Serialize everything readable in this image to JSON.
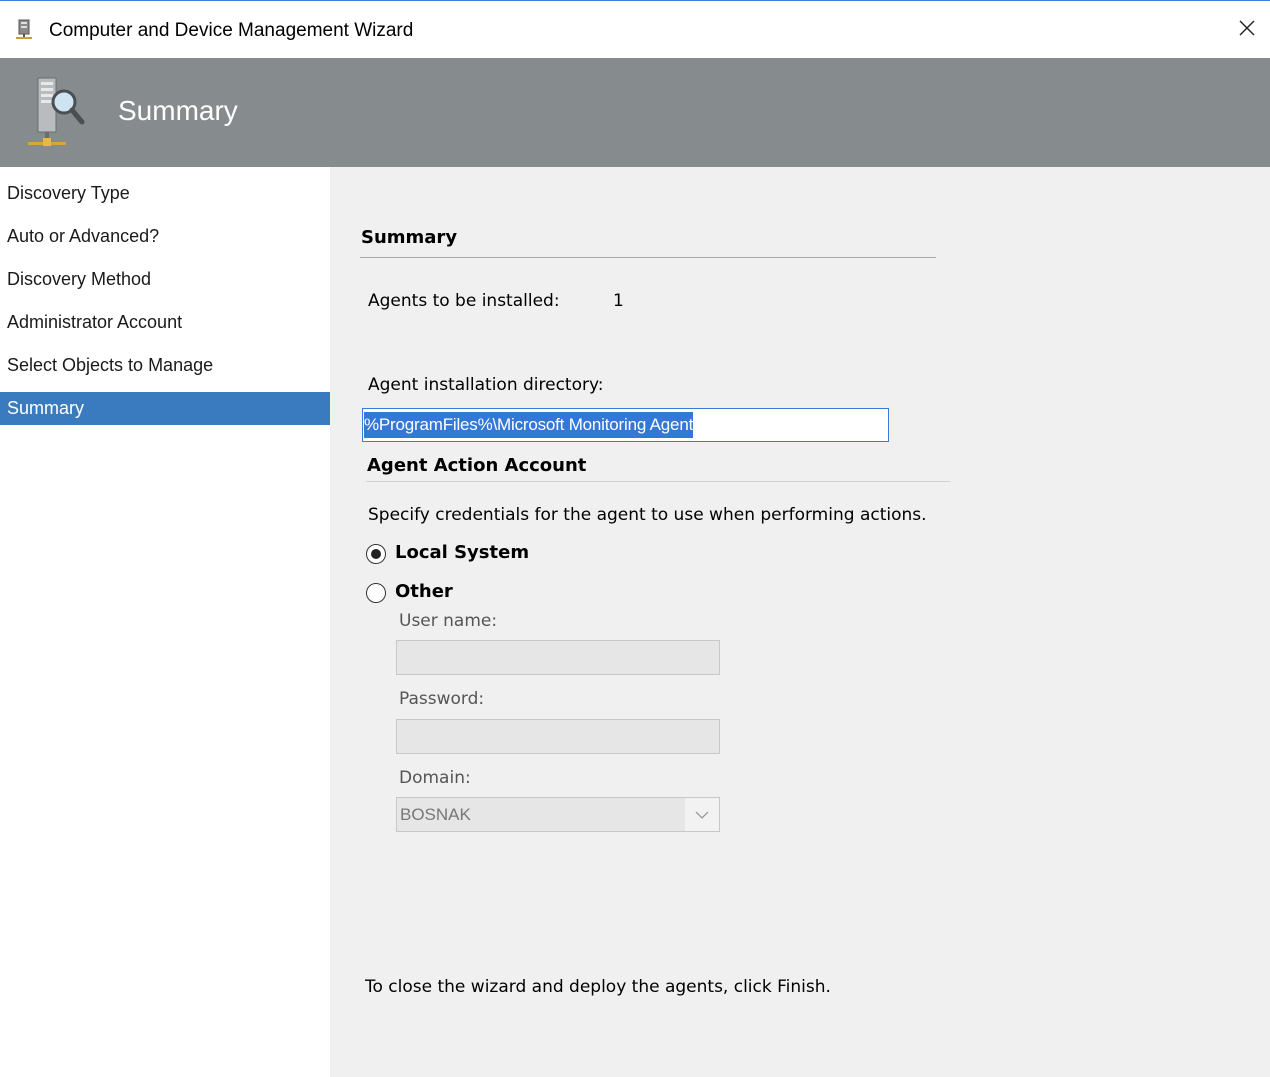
{
  "window": {
    "title": "Computer and Device Management Wizard",
    "icons": {
      "app": "server-icon",
      "close": "close-icon",
      "banner": "server-magnifier-icon"
    }
  },
  "banner": {
    "title": "Summary"
  },
  "nav": {
    "items": [
      {
        "label": "Discovery Type",
        "active": false
      },
      {
        "label": "Auto or Advanced?",
        "active": false
      },
      {
        "label": "Discovery Method",
        "active": false
      },
      {
        "label": "Administrator Account",
        "active": false
      },
      {
        "label": "Select Objects to Manage",
        "active": false
      },
      {
        "label": "Summary",
        "active": true
      }
    ]
  },
  "summary": {
    "heading": "Summary",
    "agents_label": "Agents to be installed:",
    "agents_count": "1",
    "directory_label": "Agent installation directory:",
    "directory_value": "%ProgramFiles%\\Microsoft Monitoring Agent"
  },
  "action_account": {
    "heading": "Agent Action Account",
    "description": "Specify credentials for the agent to use when performing actions.",
    "options": [
      {
        "label": "Local System",
        "selected": true
      },
      {
        "label": "Other",
        "selected": false
      }
    ],
    "username_label": "User name:",
    "username_value": "",
    "password_label": "Password:",
    "password_value": "",
    "domain_label": "Domain:",
    "domain_value": "BOSNAK"
  },
  "footer_text": "To close the wizard and deploy the agents, click Finish.",
  "colors": {
    "banner": "#868b8e",
    "nav_selected": "#3a7bbf",
    "content_bg": "#f0f0f0",
    "selection": "#3378d7"
  }
}
